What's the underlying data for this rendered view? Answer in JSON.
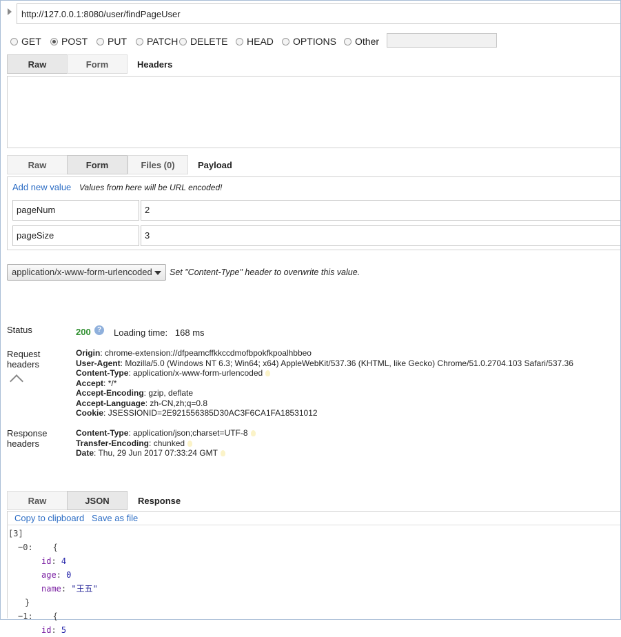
{
  "request": {
    "url": "http://127.0.0.1:8080/user/findPageUser",
    "methods": [
      {
        "label": "GET",
        "selected": false
      },
      {
        "label": "POST",
        "selected": true
      },
      {
        "label": "PUT",
        "selected": false
      },
      {
        "label": "PATCH",
        "selected": false
      },
      {
        "label": "DELETE",
        "selected": false
      },
      {
        "label": "HEAD",
        "selected": false
      },
      {
        "label": "OPTIONS",
        "selected": false
      },
      {
        "label": "Other",
        "selected": false
      }
    ],
    "other_value": ""
  },
  "headers_section": {
    "tabs": [
      "Raw",
      "Form"
    ],
    "active_tab": "Raw",
    "title": "Headers",
    "raw_value": ""
  },
  "payload_section": {
    "tabs": [
      "Raw",
      "Form",
      "Files (0)"
    ],
    "active_tab": "Form",
    "title": "Payload",
    "add_link": "Add new value",
    "note": "Values from here will be URL encoded!",
    "fields": [
      {
        "name": "pageNum",
        "value": "2"
      },
      {
        "name": "pageSize",
        "value": "3"
      }
    ],
    "content_type": "application/x-www-form-urlencoded",
    "content_type_note": "Set \"Content-Type\" header to overwrite this value."
  },
  "result": {
    "status_label": "Status",
    "status_code": "200",
    "help_glyph": "?",
    "loading_label": "Loading time:",
    "loading_value": "168 ms",
    "request_headers_label": [
      "Request",
      "headers"
    ],
    "request_headers": [
      {
        "name": "Origin",
        "value": "chrome-extension://dfpeamcffkkccdmofbpokfkpoalhbbeo",
        "bulb": false
      },
      {
        "name": "User-Agent",
        "value": "Mozilla/5.0 (Windows NT 6.3; Win64; x64) AppleWebKit/537.36 (KHTML, like Gecko) Chrome/51.0.2704.103 Safari/537.36",
        "bulb": false
      },
      {
        "name": "Content-Type",
        "value": "application/x-www-form-urlencoded",
        "bulb": true
      },
      {
        "name": "Accept",
        "value": "*/*",
        "bulb": false
      },
      {
        "name": "Accept-Encoding",
        "value": "gzip, deflate",
        "bulb": false
      },
      {
        "name": "Accept-Language",
        "value": "zh-CN,zh;q=0.8",
        "bulb": false
      },
      {
        "name": "Cookie",
        "value": "JSESSIONID=2E921556385D30AC3F6CA1FA18531012",
        "bulb": false
      }
    ],
    "response_headers_label": [
      "Response",
      "headers"
    ],
    "response_headers": [
      {
        "name": "Content-Type",
        "value": "application/json;charset=UTF-8",
        "bulb": true
      },
      {
        "name": "Transfer-Encoding",
        "value": "chunked",
        "bulb": true
      },
      {
        "name": "Date",
        "value": "Thu, 29 Jun 2017 07:33:24 GMT",
        "bulb": true
      }
    ]
  },
  "response_section": {
    "tabs": [
      "Raw",
      "JSON"
    ],
    "active_tab": "JSON",
    "title": "Response",
    "copy_link": "Copy to clipboard",
    "save_link": "Save as file",
    "json_lines": [
      {
        "indent": 0,
        "parts": [
          {
            "t": "[3]",
            "c": "json-punct"
          }
        ]
      },
      {
        "indent": 1,
        "parts": [
          {
            "t": "−",
            "c": "json-punct"
          },
          {
            "t": "0:",
            "c": "json-punct"
          },
          {
            "t": "    {",
            "c": "json-punct"
          }
        ]
      },
      {
        "indent": 3,
        "parts": [
          {
            "t": "id",
            "c": "json-key"
          },
          {
            "t": ": ",
            "c": "json-punct"
          },
          {
            "t": "4",
            "c": "json-num"
          }
        ]
      },
      {
        "indent": 3,
        "parts": [
          {
            "t": "age",
            "c": "json-key"
          },
          {
            "t": ": ",
            "c": "json-punct"
          },
          {
            "t": "0",
            "c": "json-num"
          }
        ]
      },
      {
        "indent": 3,
        "parts": [
          {
            "t": "name",
            "c": "json-key"
          },
          {
            "t": ": ",
            "c": "json-punct"
          },
          {
            "t": "\"王五\"",
            "c": "json-str"
          }
        ]
      },
      {
        "indent": 2,
        "parts": [
          {
            "t": "}",
            "c": "json-punct"
          }
        ]
      },
      {
        "indent": 1,
        "parts": [
          {
            "t": "−",
            "c": "json-punct"
          },
          {
            "t": "1:",
            "c": "json-punct"
          },
          {
            "t": "    {",
            "c": "json-punct"
          }
        ]
      },
      {
        "indent": 3,
        "parts": [
          {
            "t": "id",
            "c": "json-key"
          },
          {
            "t": ": ",
            "c": "json-punct"
          },
          {
            "t": "5",
            "c": "json-num"
          }
        ]
      }
    ]
  }
}
